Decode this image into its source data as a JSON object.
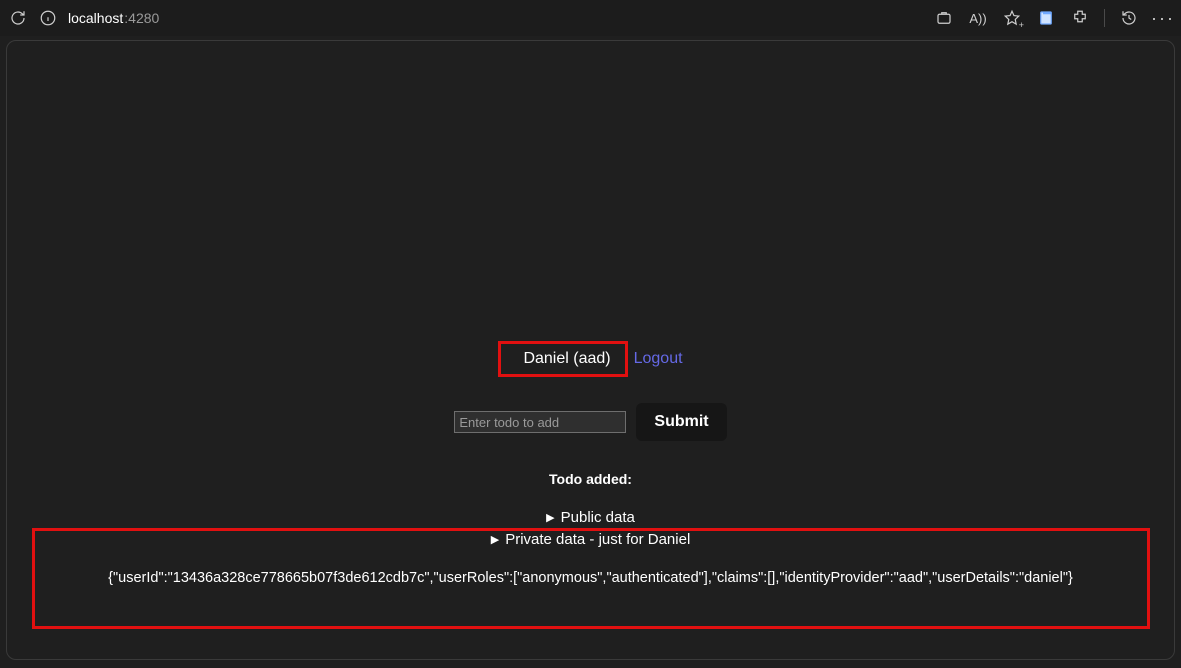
{
  "browser": {
    "url_host": "localhost",
    "url_port": ":4280",
    "readaloud": "A))"
  },
  "page": {
    "user_label": "Daniel (aad)",
    "logout": "Logout",
    "todo_placeholder": "Enter todo to add",
    "submit": "Submit",
    "todo_added": "Todo added:",
    "public_summary": "Public data",
    "private_summary": "Private data - just for Daniel",
    "user_json": "{\"userId\":\"13436a328ce778665b07f3de612cdb7c\",\"userRoles\":[\"anonymous\",\"authenticated\"],\"claims\":[],\"identityProvider\":\"aad\",\"userDetails\":\"daniel\"}"
  }
}
